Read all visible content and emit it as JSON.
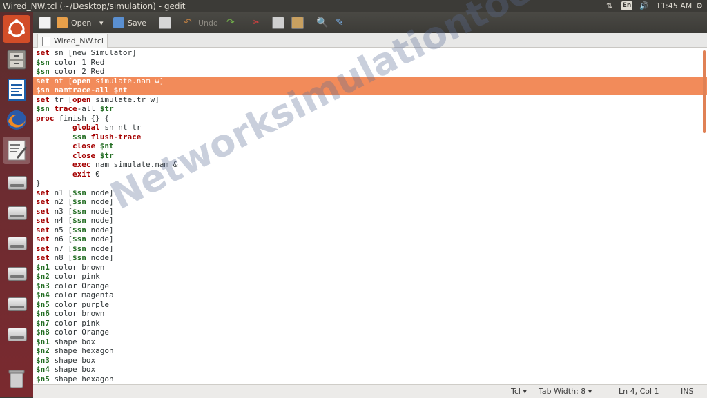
{
  "window": {
    "title": "Wired_NW.tcl (~/Desktop/simulation) - gedit"
  },
  "panel": {
    "keyboard": "En",
    "time": "11:45 AM"
  },
  "toolbar": {
    "open_label": "Open",
    "save_label": "Save",
    "undo_label": "Undo"
  },
  "tab": {
    "name": "Wired_NW.tcl"
  },
  "code": [
    [
      {
        "t": "set",
        "c": "set"
      },
      {
        "t": " sn [new Simulator]"
      }
    ],
    [
      {
        "t": "$sn",
        "c": "var"
      },
      {
        "t": " color 1 Red"
      }
    ],
    [
      {
        "t": "$sn",
        "c": "var"
      },
      {
        "t": " color 2 Red"
      }
    ],
    [
      {
        "t": "set",
        "c": "set"
      },
      {
        "t": " nt ["
      },
      {
        "t": "open",
        "c": "kw"
      },
      {
        "t": " simulate.nam w]"
      }
    ],
    [
      {
        "t": "$sn",
        "c": "var"
      },
      {
        "t": " "
      },
      {
        "t": "namtrace-all",
        "c": "kw"
      },
      {
        "t": " "
      },
      {
        "t": "$nt",
        "c": "var"
      }
    ],
    [
      {
        "t": "set",
        "c": "set"
      },
      {
        "t": " tr ["
      },
      {
        "t": "open",
        "c": "kw"
      },
      {
        "t": " simulate.tr w]"
      }
    ],
    [
      {
        "t": "$sn",
        "c": "var"
      },
      {
        "t": " "
      },
      {
        "t": "trace",
        "c": "kw"
      },
      {
        "t": "-all "
      },
      {
        "t": "$tr",
        "c": "var"
      }
    ],
    [
      {
        "t": "proc",
        "c": "kw"
      },
      {
        "t": " finish {} {"
      }
    ],
    [
      {
        "t": "        "
      },
      {
        "t": "global",
        "c": "kw"
      },
      {
        "t": " sn nt tr"
      }
    ],
    [
      {
        "t": "        "
      },
      {
        "t": "$sn",
        "c": "var"
      },
      {
        "t": " "
      },
      {
        "t": "flush-trace",
        "c": "kw"
      }
    ],
    [
      {
        "t": "        "
      },
      {
        "t": "close",
        "c": "kw"
      },
      {
        "t": " "
      },
      {
        "t": "$nt",
        "c": "var"
      }
    ],
    [
      {
        "t": "        "
      },
      {
        "t": "close",
        "c": "kw"
      },
      {
        "t": " "
      },
      {
        "t": "$tr",
        "c": "var"
      }
    ],
    [
      {
        "t": "        "
      },
      {
        "t": "exec",
        "c": "kw"
      },
      {
        "t": " nam simulate.nam &"
      }
    ],
    [
      {
        "t": "        "
      },
      {
        "t": "exit",
        "c": "kw"
      },
      {
        "t": " 0"
      }
    ],
    [
      {
        "t": "}"
      }
    ],
    [
      {
        "t": "set",
        "c": "set"
      },
      {
        "t": " n1 ["
      },
      {
        "t": "$sn",
        "c": "var"
      },
      {
        "t": " node]"
      }
    ],
    [
      {
        "t": "set",
        "c": "set"
      },
      {
        "t": " n2 ["
      },
      {
        "t": "$sn",
        "c": "var"
      },
      {
        "t": " node]"
      }
    ],
    [
      {
        "t": "set",
        "c": "set"
      },
      {
        "t": " n3 ["
      },
      {
        "t": "$sn",
        "c": "var"
      },
      {
        "t": " node]"
      }
    ],
    [
      {
        "t": "set",
        "c": "set"
      },
      {
        "t": " n4 ["
      },
      {
        "t": "$sn",
        "c": "var"
      },
      {
        "t": " node]"
      }
    ],
    [
      {
        "t": "set",
        "c": "set"
      },
      {
        "t": " n5 ["
      },
      {
        "t": "$sn",
        "c": "var"
      },
      {
        "t": " node]"
      }
    ],
    [
      {
        "t": "set",
        "c": "set"
      },
      {
        "t": " n6 ["
      },
      {
        "t": "$sn",
        "c": "var"
      },
      {
        "t": " node]"
      }
    ],
    [
      {
        "t": "set",
        "c": "set"
      },
      {
        "t": " n7 ["
      },
      {
        "t": "$sn",
        "c": "var"
      },
      {
        "t": " node]"
      }
    ],
    [
      {
        "t": "set",
        "c": "set"
      },
      {
        "t": " n8 ["
      },
      {
        "t": "$sn",
        "c": "var"
      },
      {
        "t": " node]"
      }
    ],
    [
      {
        "t": "$n1",
        "c": "var"
      },
      {
        "t": " color brown"
      }
    ],
    [
      {
        "t": "$n2",
        "c": "var"
      },
      {
        "t": " color pink"
      }
    ],
    [
      {
        "t": "$n3",
        "c": "var"
      },
      {
        "t": " color Orange"
      }
    ],
    [
      {
        "t": "$n4",
        "c": "var"
      },
      {
        "t": " color magenta"
      }
    ],
    [
      {
        "t": "$n5",
        "c": "var"
      },
      {
        "t": " color purple"
      }
    ],
    [
      {
        "t": "$n6",
        "c": "var"
      },
      {
        "t": " color brown"
      }
    ],
    [
      {
        "t": "$n7",
        "c": "var"
      },
      {
        "t": " color pink"
      }
    ],
    [
      {
        "t": "$n8",
        "c": "var"
      },
      {
        "t": " color Orange"
      }
    ],
    [
      {
        "t": "$n1",
        "c": "var"
      },
      {
        "t": " shape box"
      }
    ],
    [
      {
        "t": "$n2",
        "c": "var"
      },
      {
        "t": " shape hexagon"
      }
    ],
    [
      {
        "t": "$n3",
        "c": "var"
      },
      {
        "t": " shape box"
      }
    ],
    [
      {
        "t": "$n4",
        "c": "var"
      },
      {
        "t": " shape box"
      }
    ],
    [
      {
        "t": "$n5",
        "c": "var"
      },
      {
        "t": " shape hexagon"
      }
    ]
  ],
  "highlighted_lines": [
    4,
    5
  ],
  "watermark": "Networksimulationtools.com",
  "status": {
    "language": "Tcl",
    "tab_width": "Tab Width: 8",
    "position": "Ln 4, Col 1",
    "mode": "INS"
  },
  "colors": {
    "selection": "#f28b5a",
    "keyword": "#a40000",
    "variable": "#246e24",
    "launcher": "#6b2c31"
  },
  "icons": [
    "dash-ubuntu-icon",
    "files-icon",
    "writer-icon",
    "firefox-icon",
    "text-editor-icon",
    "drive-icon",
    "trash-icon"
  ]
}
